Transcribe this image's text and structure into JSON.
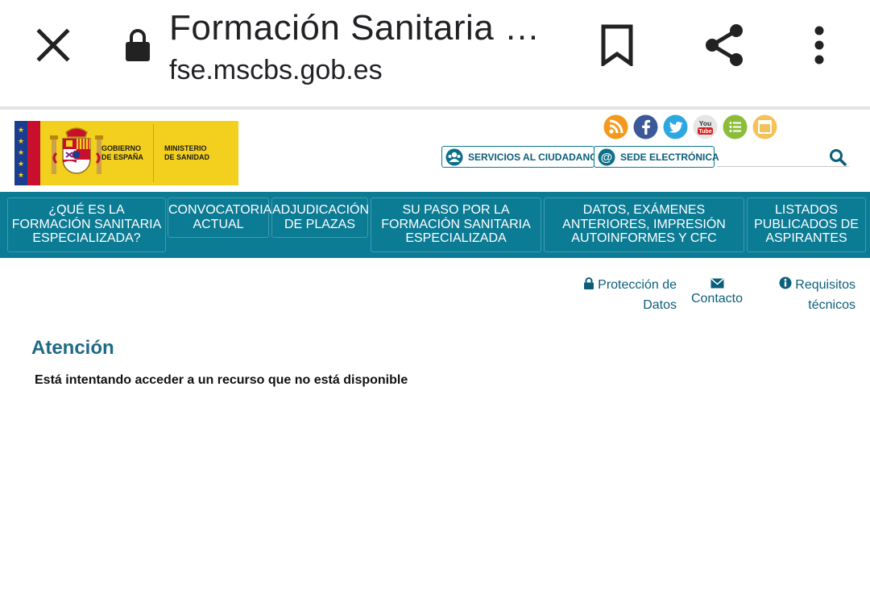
{
  "browser": {
    "title": "Formación Sanitaria …",
    "url": "fse.mscbs.gob.es",
    "icons": [
      "close-icon",
      "lock-icon",
      "bookmark-icon",
      "share-icon",
      "more-vert-icon"
    ]
  },
  "header": {
    "logo": {
      "left_text": "GOBIERNO\nDE ESPAÑA",
      "right_text": "MINISTERIO\nDE SANIDAD"
    },
    "social": [
      "rss-icon",
      "facebook-icon",
      "twitter-icon",
      "youtube-icon",
      "list-icon",
      "calendar-icon"
    ],
    "services_button": "SERVICIOS AL CIUDADANO",
    "sede_button": "SEDE ELECTRÓNICA",
    "youtube_text": "You Tube"
  },
  "nav": [
    "¿QUÉ ES LA FORMACIÓN SANITARIA ESPECIALIZADA?",
    "CONVOCATORIA ACTUAL",
    "ADJUDICACIÓN DE PLAZAS",
    "SU PASO POR LA FORMACIÓN SANITARIA ESPECIALIZADA",
    "DATOS, EXÁMENES ANTERIORES, IMPRESIÓN AUTOINFORMES Y CFC",
    "LISTADOS PUBLICADOS DE ASPIRANTES"
  ],
  "utility": {
    "privacy": "Protección de Datos",
    "contact": "Contacto",
    "requirements": "Requisitos técnicos"
  },
  "content": {
    "title": "Atención",
    "message": "Está intentando acceder a un recurso que no está disponible"
  },
  "colors": {
    "nav_bg": "#0c7b94",
    "title": "#1f6a86",
    "link": "#0b5e7a",
    "logo_yellow": "#f4d01e"
  }
}
